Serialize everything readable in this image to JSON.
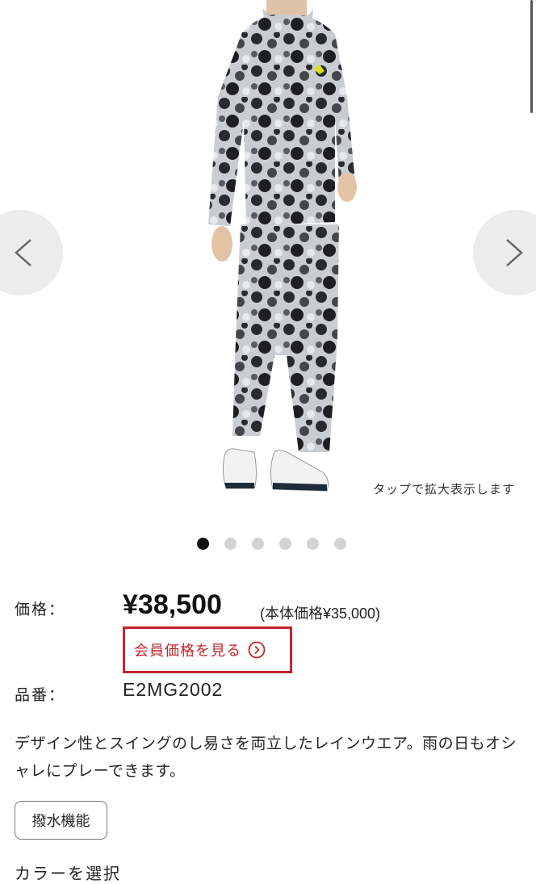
{
  "gallery": {
    "zoom_hint": "タップで拡大表示します",
    "prev_icon": "chevron-left-icon",
    "next_icon": "chevron-right-icon",
    "total_images": 6,
    "active_index": 0
  },
  "price": {
    "label": "価格：",
    "amount": "¥38,500",
    "tax_note": "(本体価格¥35,000)",
    "member_button_label": "会員価格を見る",
    "member_button_icon": "circle-chevron-right-icon",
    "accent_color": "#c0272d"
  },
  "sku": {
    "label": "品番：",
    "value": "E2MG2002"
  },
  "description": "デザイン性とスイングのし易さを両立したレインウエア。雨の日もオシャレにプレーできます。",
  "feature_tag": "撥水機能",
  "color_heading": "カラーを選択"
}
